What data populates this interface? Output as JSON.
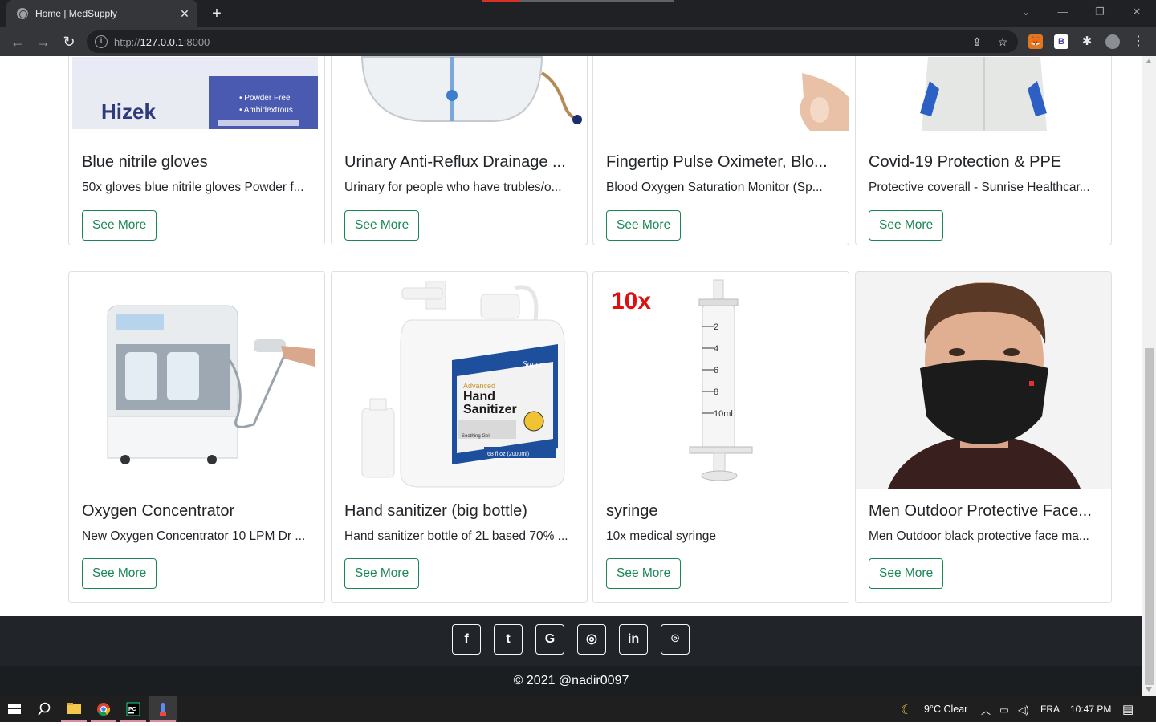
{
  "browser": {
    "tab_title": "Home | MedSupply",
    "url_scheme": "http://",
    "url_host": "127.0.0.1",
    "url_port": ":8000"
  },
  "products": [
    {
      "title": "Blue nitrile gloves",
      "desc": "50x gloves blue nitrile gloves Powder f...",
      "button": "See More",
      "image": "nitrile-gloves-box-image",
      "image_brand": "Hizek",
      "image_lines": [
        "• Powder Free",
        "• Ambidextrous"
      ]
    },
    {
      "title": "Urinary Anti-Reflux Drainage ...",
      "desc": "Urinary for people who have trubles/o...",
      "button": "See More",
      "image": "urinary-drainage-bag-image"
    },
    {
      "title": "Fingertip Pulse Oximeter, Blo...",
      "desc": "Blood Oxygen Saturation Monitor (Sp...",
      "button": "See More",
      "image": "pulse-oximeter-image"
    },
    {
      "title": "Covid-19 Protection & PPE",
      "desc": "Protective coverall - Sunrise Healthcar...",
      "button": "See More",
      "image": "ppe-coverall-image"
    },
    {
      "title": "Oxygen Concentrator",
      "desc": "New Oxygen Concentrator 10 LPM Dr ...",
      "button": "See More",
      "image": "oxygen-concentrator-image"
    },
    {
      "title": "Hand sanitizer (big bottle)",
      "desc": "Hand sanitizer bottle of 2L based 70% ...",
      "button": "See More",
      "image": "hand-sanitizer-bottle-image",
      "image_brand": "Super",
      "image_lines": [
        "Advanced",
        "Hand",
        "Sanitizer",
        "Soothing Gel",
        "68 fl oz (2000ml)"
      ]
    },
    {
      "title": "syringe",
      "desc": "10x medical syringe",
      "button": "See More",
      "image": "syringe-image",
      "image_badge": "10x",
      "image_lines": [
        "2",
        "4",
        "6",
        "8",
        "10ml"
      ]
    },
    {
      "title": "Men Outdoor Protective Face...",
      "desc": "Men Outdoor black protective face ma...",
      "button": "See More",
      "image": "face-mask-man-image"
    }
  ],
  "footer": {
    "social": [
      {
        "icon": "facebook-icon",
        "glyph": "f"
      },
      {
        "icon": "twitter-icon",
        "glyph": "t"
      },
      {
        "icon": "google-icon",
        "glyph": "G"
      },
      {
        "icon": "instagram-icon",
        "glyph": "◎"
      },
      {
        "icon": "linkedin-icon",
        "glyph": "in"
      },
      {
        "icon": "github-icon",
        "glyph": "⌾"
      }
    ],
    "copyright": "© 2021 @nadir0097"
  },
  "taskbar": {
    "weather": "9°C  Clear",
    "language": "FRA",
    "time": "10:47 PM"
  },
  "colors": {
    "accent": "#198754",
    "footer": "#212529",
    "footer_bottom": "#1b1e21",
    "chrome": "#35363a"
  }
}
